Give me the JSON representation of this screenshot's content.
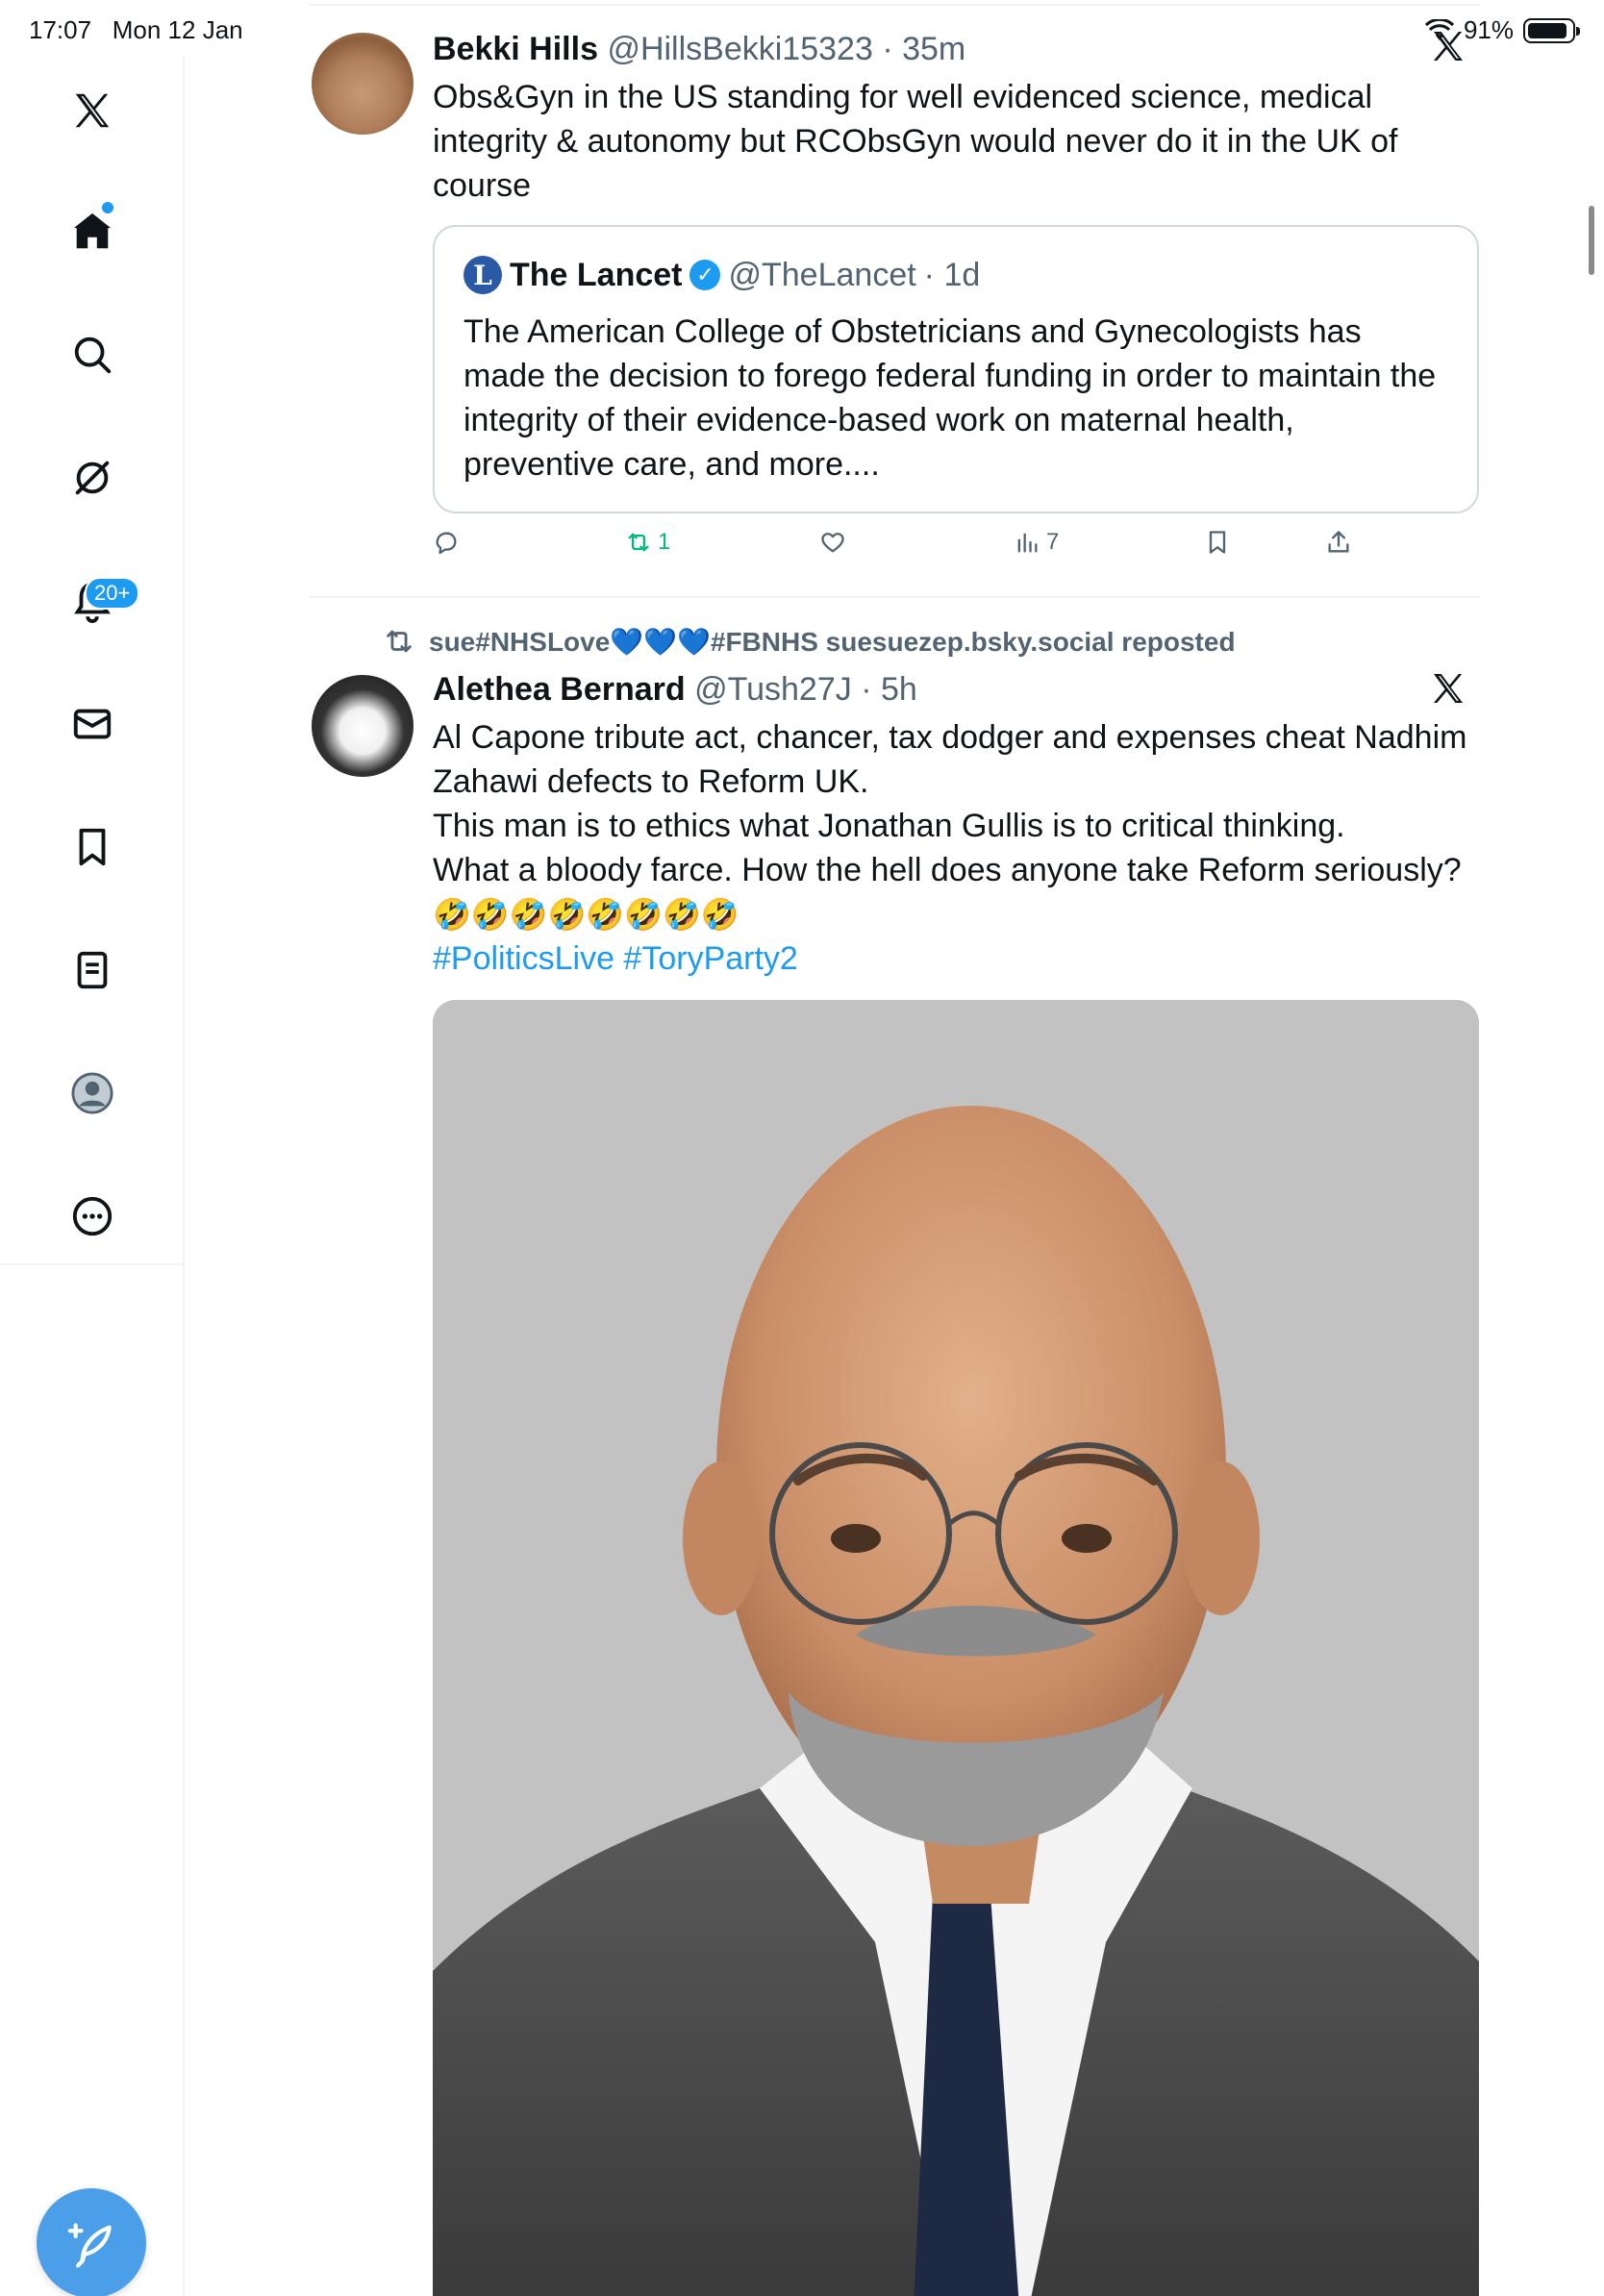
{
  "status_bar": {
    "time": "17:07",
    "date": "Mon 12 Jan",
    "battery": "91%",
    "battery_level": 0.91
  },
  "sidebar": {
    "items": [
      {
        "icon": "x-logo-icon"
      },
      {
        "icon": "home-icon",
        "has_dot": true
      },
      {
        "icon": "search-icon"
      },
      {
        "icon": "grok-icon"
      },
      {
        "icon": "bell-icon",
        "badge": "20+"
      },
      {
        "icon": "mail-icon"
      },
      {
        "icon": "bookmark-icon"
      },
      {
        "icon": "lists-icon"
      },
      {
        "icon": "profile-icon"
      },
      {
        "icon": "more-icon"
      }
    ],
    "compose_icon": "compose-icon",
    "accent": "#1d9bf0"
  },
  "tweets": [
    {
      "name": "Bekki Hills",
      "handle": "@HillsBekki15323",
      "time": "· 35m",
      "text_lines": [
        "Obs&Gyn in the US standing for well evidenced science, medical",
        "integrity & autonomy but RCObsGyn would never do it in the UK of",
        "course"
      ],
      "quote": {
        "name": "The Lancet",
        "handle": "@TheLancet",
        "time": "· 1d",
        "logo_letter": "L",
        "text_lines": [
          "The American College of Obstetricians and Gynecologists has",
          "made the decision to forego federal funding in order to maintain the",
          "integrity of their evidence-based work on maternal health,",
          "preventive care, and more...."
        ]
      },
      "actions": {
        "reply_count": "",
        "retweet_count": "1",
        "like_count": "",
        "views_count": "7"
      }
    },
    {
      "repost_label": "sue#NHSLove💙💙💙#FBNHS suesuezep.bsky.social reposted",
      "name": "Alethea Bernard",
      "handle": "@Tush27J",
      "time": "· 5h",
      "text_lines": [
        "Al Capone tribute act, chancer, tax dodger and expenses cheat Nadhim",
        "Zahawi defects to Reform UK.",
        "This man is to ethics what Jonathan Gullis is to critical thinking.",
        "What a bloody farce. How the hell does anyone take Reform seriously?"
      ],
      "emoji": "🤣🤣🤣🤣🤣🤣🤣🤣",
      "hashtags": "#PoliticsLive #ToryParty2"
    }
  ]
}
